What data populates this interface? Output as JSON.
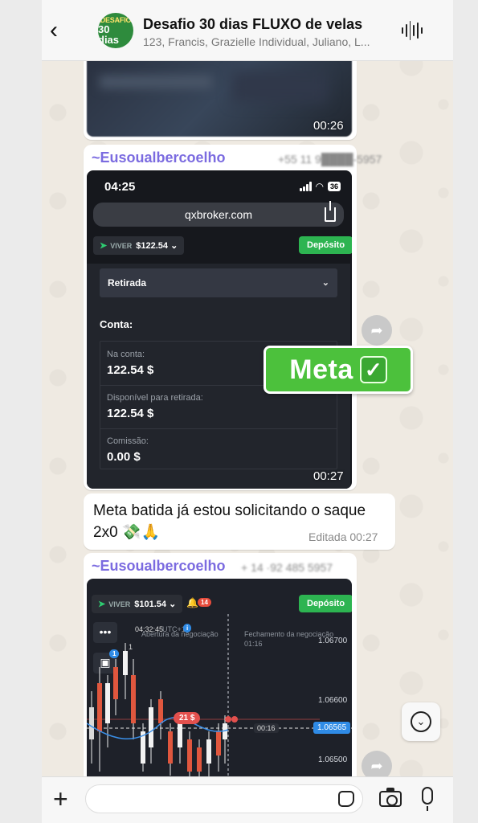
{
  "header": {
    "back_glyph": "‹",
    "avatar_line1": "DESAFIO",
    "avatar_line2": "30 dias",
    "title": "Desafio 30 dias FLUXO de velas",
    "members": "123, Francis, Grazielle Individual, Juliano, L..."
  },
  "messages": {
    "video1": {
      "time": "00:26"
    },
    "image1": {
      "sender": "~Eusoualbercoelho",
      "phone": "+55 11 9████-5957",
      "time": "00:27",
      "screenshot": {
        "status_time": "04:25",
        "battery": "36",
        "url": "qxbroker.com",
        "live_label": "VIVER",
        "balance": "$122.54",
        "deposit_label": "Depósito",
        "select_label": "Retirada",
        "conta_label": "Conta:",
        "rows": [
          {
            "label": "Na conta:",
            "value": "122.54 $"
          },
          {
            "label": "Disponível para retirada:",
            "value": "122.54 $"
          },
          {
            "label": "Comissão:",
            "value": "0.00 $"
          }
        ]
      }
    },
    "sticker": {
      "text": "Meta",
      "check": "✓"
    },
    "text1": {
      "body": "Meta batida já estou solicitando o saque 2x0 💸🙏",
      "edited_label": "Editada 00:27"
    },
    "image2": {
      "sender": "~Eusoualbercoelho",
      "phone": "+ 14 ·92 485 5957",
      "screenshot": {
        "live_label": "VIVER",
        "balance": "$101.54",
        "notif_count": "14",
        "deposit_label": "Depósito",
        "trade_time": "04:32:45",
        "trade_tz": "UTC+1",
        "open_label": "Abertura da negociação",
        "close_label": "Fechamento da negociação",
        "close_time": "01:16",
        "prices": [
          "1.06700",
          "1.06600",
          "1.06500"
        ],
        "current_price": "1.06565",
        "trade_amount": "21 $",
        "timer": "00:16",
        "menu_dots": "•••",
        "badge_one": "1",
        "info_i": "i",
        "step_one": "1"
      }
    }
  },
  "icons": {
    "back": "chevron-left-icon",
    "voice": "audio-wave-icon",
    "forward": "forward-icon",
    "scroll_down": "chevron-down-icon",
    "plus": "plus-icon",
    "sticker": "sticker-icon",
    "camera": "camera-icon",
    "mic": "microphone-icon"
  },
  "colors": {
    "sender_name": "#7b6be0",
    "deposit_green": "#2db451",
    "sticker_green": "#4cc13c",
    "chat_background": "#efeae2"
  }
}
